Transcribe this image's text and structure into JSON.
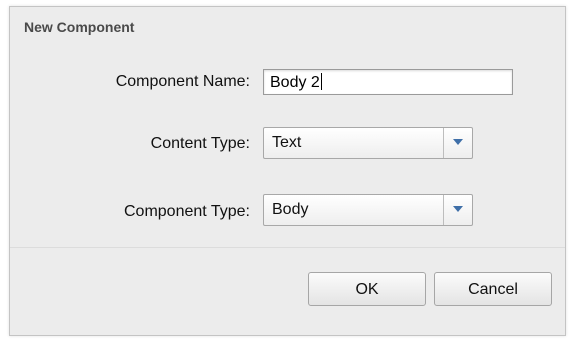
{
  "dialog": {
    "title": "New Component"
  },
  "form": {
    "component_name": {
      "label": "Component Name:",
      "value": "Body 2"
    },
    "content_type": {
      "label": "Content Type:",
      "selected": "Text"
    },
    "component_type": {
      "label": "Component Type:",
      "selected": "Body"
    }
  },
  "buttons": {
    "ok": "OK",
    "cancel": "Cancel"
  }
}
